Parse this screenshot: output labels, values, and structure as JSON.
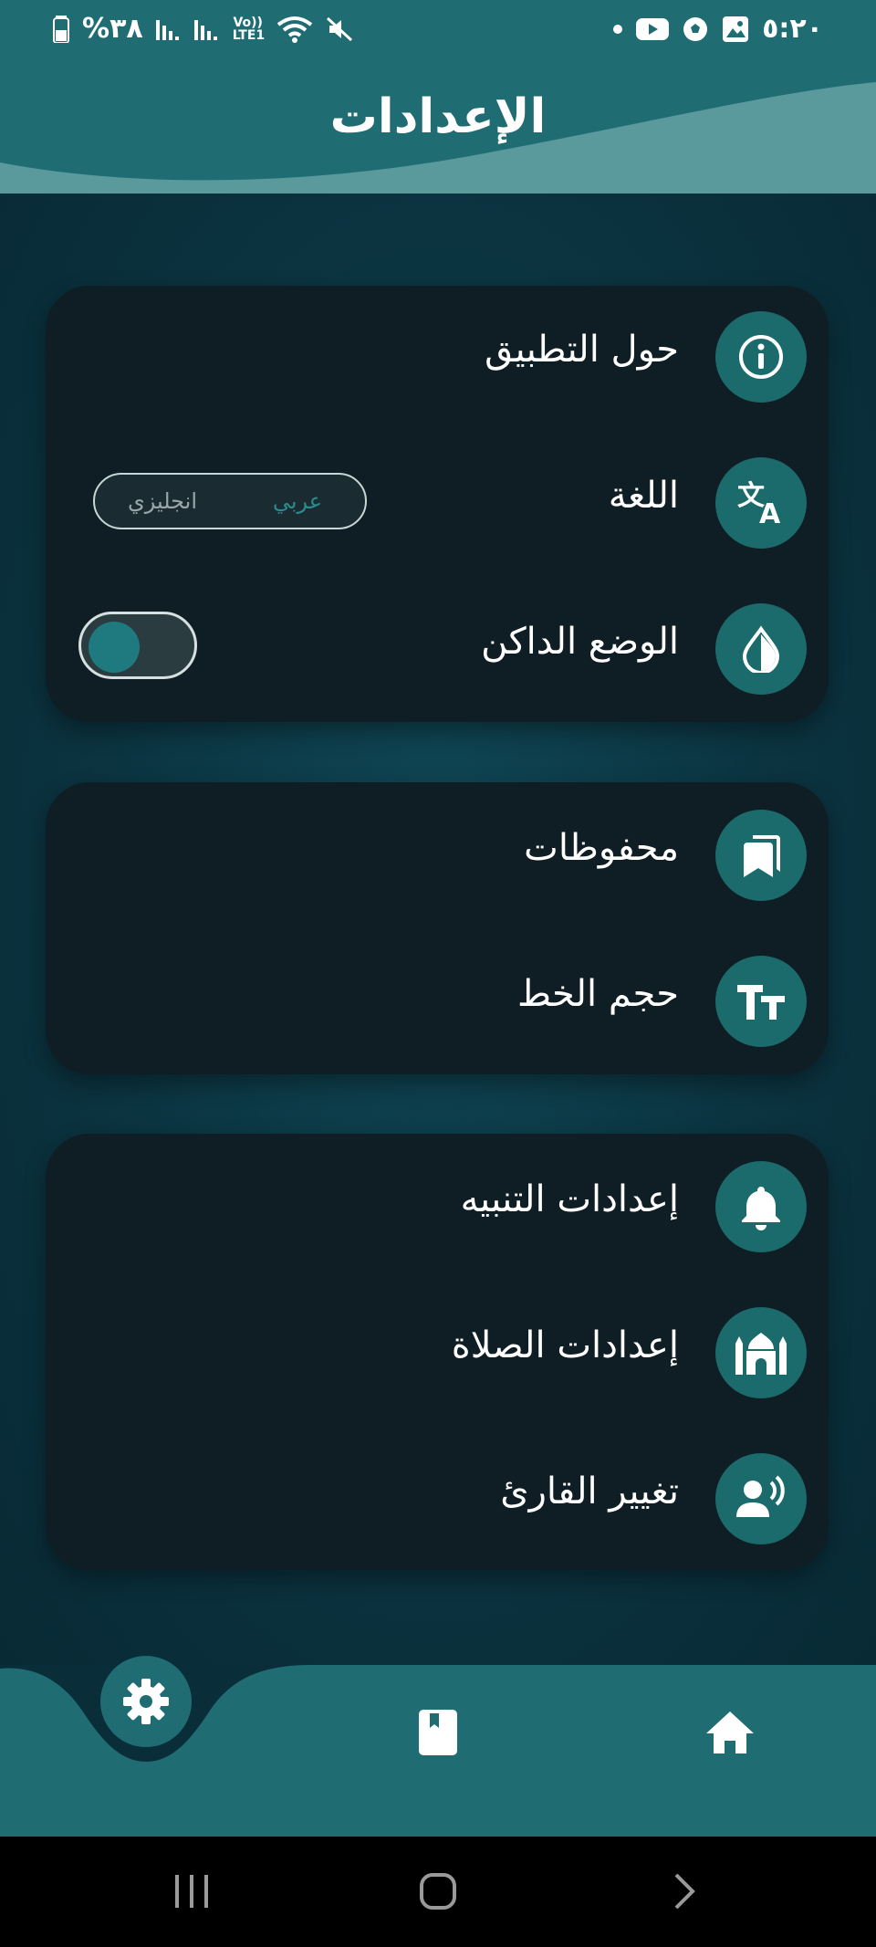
{
  "status_bar": {
    "time": "٥:٢٠",
    "battery": "%٣٨",
    "network_label": "Vo)) LTE1"
  },
  "header": {
    "title": "الإعدادات"
  },
  "cards": [
    {
      "rows": [
        {
          "label": "حول التطبيق",
          "icon": "info-icon"
        },
        {
          "label": "اللغة",
          "icon": "translate-icon"
        },
        {
          "label": "الوضع الداكن",
          "icon": "drop-icon"
        }
      ]
    },
    {
      "rows": [
        {
          "label": "محفوظات",
          "icon": "bookmarks-icon"
        },
        {
          "label": "حجم الخط",
          "icon": "text-size-icon"
        }
      ]
    },
    {
      "rows": [
        {
          "label": "إعدادات التنبيه",
          "icon": "bell-icon"
        },
        {
          "label": "إعدادات الصلاة",
          "icon": "mosque-icon"
        },
        {
          "label": "تغيير القارئ",
          "icon": "speaker-person-icon"
        }
      ]
    }
  ],
  "language_toggle": {
    "arabic": "عربي",
    "english": "انجليزي",
    "selected": "عربي"
  },
  "dark_mode": {
    "enabled": false
  },
  "bottom_nav": {
    "items": [
      "gear-icon",
      "book-icon",
      "home-icon"
    ],
    "active": "gear-icon"
  },
  "colors": {
    "accent": "#1f6d73",
    "icon_circle": "#1b6a6c",
    "card": "#0f1e24",
    "background": "#0a2d3a",
    "wave_light": "#5a9a9c"
  }
}
